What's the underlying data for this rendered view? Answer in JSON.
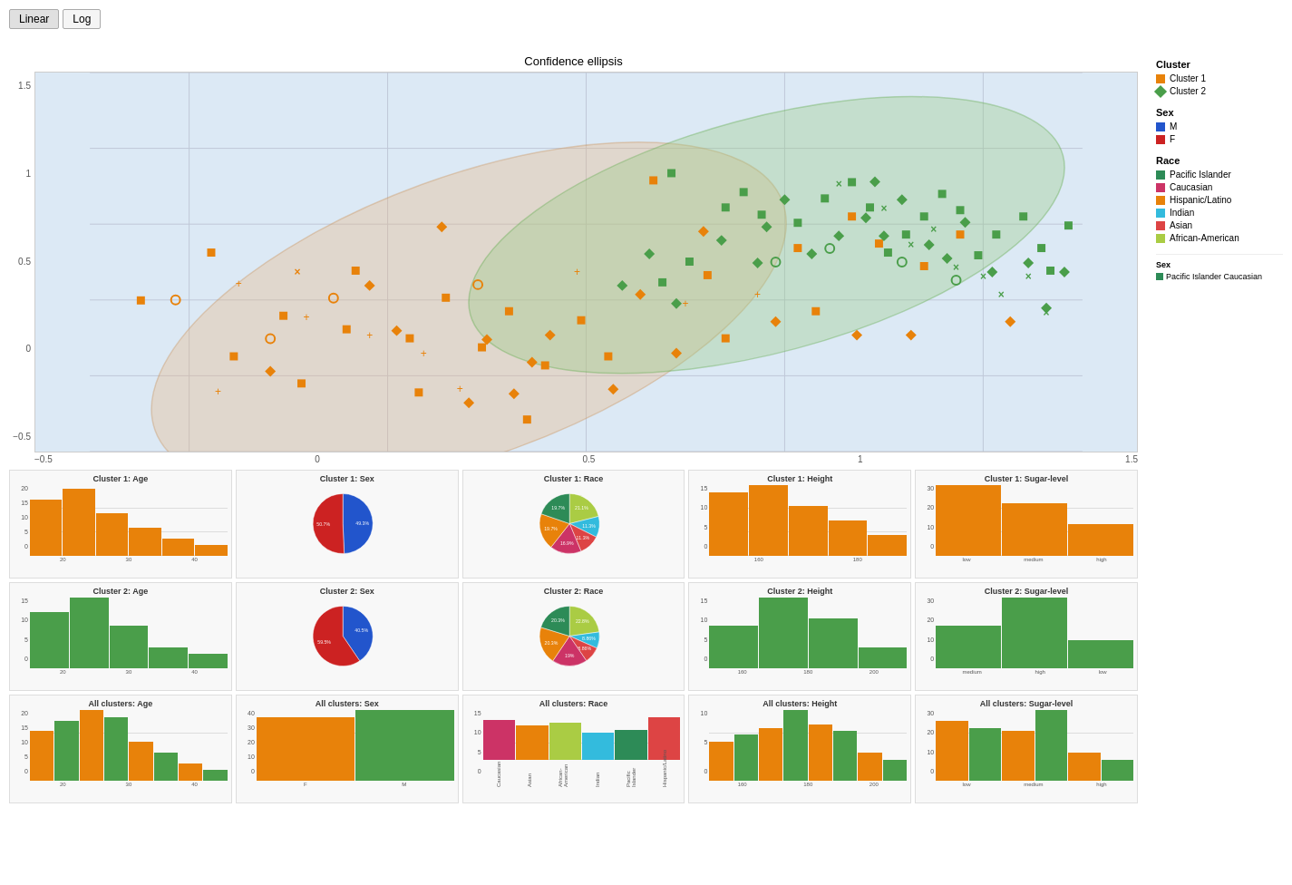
{
  "buttons": {
    "linear_label": "Linear",
    "log_label": "Log"
  },
  "scatter": {
    "title": "Confidence ellipsis",
    "x_ticks": [
      "-0.5",
      "0",
      "0.5",
      "1",
      "1.5"
    ],
    "y_ticks": [
      "1.5",
      "1",
      "0.5",
      "0",
      "-0.5"
    ]
  },
  "legend": {
    "cluster_title": "Cluster",
    "cluster_items": [
      {
        "label": "Cluster 1",
        "color": "#E8820A",
        "shape": "square"
      },
      {
        "label": "Cluster 2",
        "color": "#4A9E4A",
        "shape": "diamond"
      }
    ],
    "sex_title": "Sex",
    "sex_items": [
      {
        "label": "M",
        "color": "#2255CC"
      },
      {
        "label": "F",
        "color": "#CC2222"
      }
    ],
    "race_title": "Race",
    "race_items": [
      {
        "label": "Pacific Islander",
        "color": "#2D8B57"
      },
      {
        "label": "Caucasian",
        "color": "#CC3366"
      },
      {
        "label": "Hispanic/Latino",
        "color": "#E8820A"
      },
      {
        "label": "Indian",
        "color": "#33BBDD"
      },
      {
        "label": "Asian",
        "color": "#DD4444"
      },
      {
        "label": "African-American",
        "color": "#AACC44"
      }
    ]
  },
  "mini_charts": {
    "row1": [
      {
        "title": "Cluster 1: Age",
        "type": "bar",
        "y_max": 20,
        "y_ticks": [
          "20",
          "15",
          "10",
          "5",
          "0"
        ],
        "x_ticks": [
          "20",
          "30",
          "40"
        ],
        "bars": [
          {
            "height": 80,
            "color": "#E8820A"
          },
          {
            "height": 95,
            "color": "#E8820A"
          },
          {
            "height": 60,
            "color": "#E8820A"
          },
          {
            "height": 40,
            "color": "#E8820A"
          },
          {
            "height": 25,
            "color": "#E8820A"
          },
          {
            "height": 15,
            "color": "#E8820A"
          }
        ]
      },
      {
        "title": "Cluster 1: Sex",
        "type": "pie",
        "segments": [
          {
            "label": "49.3%",
            "color": "#2255CC",
            "pct": 49.3
          },
          {
            "label": "50.7%",
            "color": "#CC2222",
            "pct": 50.7
          }
        ]
      },
      {
        "title": "Cluster 1: Race",
        "type": "pie",
        "segments": [
          {
            "label": "21.1%",
            "color": "#AACC44",
            "pct": 21.1
          },
          {
            "label": "11.3%",
            "color": "#33BBDD",
            "pct": 11.3
          },
          {
            "label": "11.3%",
            "color": "#DD4444",
            "pct": 11.3
          },
          {
            "label": "16.9%",
            "color": "#CC3366",
            "pct": 16.9
          },
          {
            "label": "19.7%",
            "color": "#E8820A",
            "pct": 19.7
          },
          {
            "label": "19.7%",
            "color": "#2D8B57",
            "pct": 19.7
          }
        ]
      },
      {
        "title": "Cluster 1: Height",
        "type": "bar",
        "y_max": 15,
        "y_ticks": [
          "15",
          "10",
          "5",
          "0"
        ],
        "x_ticks": [
          "160",
          "180"
        ],
        "bars": [
          {
            "height": 90,
            "color": "#E8820A"
          },
          {
            "height": 100,
            "color": "#E8820A"
          },
          {
            "height": 70,
            "color": "#E8820A"
          },
          {
            "height": 50,
            "color": "#E8820A"
          },
          {
            "height": 30,
            "color": "#E8820A"
          }
        ]
      },
      {
        "title": "Cluster 1: Sugar-level",
        "type": "bar",
        "y_max": 30,
        "y_ticks": [
          "30",
          "20",
          "10",
          "0"
        ],
        "x_ticks": [
          "low",
          "medium",
          "high"
        ],
        "bars": [
          {
            "height": 100,
            "color": "#E8820A"
          },
          {
            "height": 75,
            "color": "#E8820A"
          },
          {
            "height": 45,
            "color": "#E8820A"
          }
        ]
      }
    ],
    "row2": [
      {
        "title": "Cluster 2: Age",
        "type": "bar",
        "y_max": 15,
        "y_ticks": [
          "15",
          "10",
          "5",
          "0"
        ],
        "x_ticks": [
          "20",
          "30",
          "40"
        ],
        "bars": [
          {
            "height": 80,
            "color": "#4A9E4A"
          },
          {
            "height": 100,
            "color": "#4A9E4A"
          },
          {
            "height": 60,
            "color": "#4A9E4A"
          },
          {
            "height": 30,
            "color": "#4A9E4A"
          },
          {
            "height": 20,
            "color": "#4A9E4A"
          }
        ]
      },
      {
        "title": "Cluster 2: Sex",
        "type": "pie",
        "segments": [
          {
            "label": "40.5%",
            "color": "#2255CC",
            "pct": 40.5
          },
          {
            "label": "59.5%",
            "color": "#CC2222",
            "pct": 59.5
          }
        ]
      },
      {
        "title": "Cluster 2: Race",
        "type": "pie",
        "segments": [
          {
            "label": "22.8%",
            "color": "#AACC44",
            "pct": 22.8
          },
          {
            "label": "8.86%",
            "color": "#33BBDD",
            "pct": 8.86
          },
          {
            "label": "8.86%",
            "color": "#DD4444",
            "pct": 8.86
          },
          {
            "label": "19%",
            "color": "#CC3366",
            "pct": 19
          },
          {
            "label": "20.3%",
            "color": "#E8820A",
            "pct": 20.3
          },
          {
            "label": "20.3%",
            "color": "#2D8B57",
            "pct": 20.3
          }
        ]
      },
      {
        "title": "Cluster 2: Height",
        "type": "bar",
        "y_max": 15,
        "y_ticks": [
          "15",
          "10",
          "5",
          "0"
        ],
        "x_ticks": [
          "160",
          "180",
          "200"
        ],
        "bars": [
          {
            "height": 60,
            "color": "#4A9E4A"
          },
          {
            "height": 100,
            "color": "#4A9E4A"
          },
          {
            "height": 70,
            "color": "#4A9E4A"
          },
          {
            "height": 30,
            "color": "#4A9E4A"
          }
        ]
      },
      {
        "title": "Cluster 2: Sugar-level",
        "type": "bar",
        "y_max": 30,
        "y_ticks": [
          "30",
          "20",
          "10",
          "0"
        ],
        "x_ticks": [
          "medium",
          "high",
          "low"
        ],
        "bars": [
          {
            "height": 60,
            "color": "#4A9E4A"
          },
          {
            "height": 100,
            "color": "#4A9E4A"
          },
          {
            "height": 40,
            "color": "#4A9E4A"
          }
        ]
      }
    ],
    "row3": [
      {
        "title": "All clusters: Age",
        "type": "bar",
        "y_max": 20,
        "y_ticks": [
          "20",
          "15",
          "10",
          "5",
          "0"
        ],
        "x_ticks": [
          "20",
          "30",
          "40"
        ],
        "bars": [
          {
            "height": 70,
            "color": "#E8820A"
          },
          {
            "height": 85,
            "color": "#4A9E4A"
          },
          {
            "height": 100,
            "color": "#E8820A"
          },
          {
            "height": 90,
            "color": "#4A9E4A"
          },
          {
            "height": 55,
            "color": "#E8820A"
          },
          {
            "height": 40,
            "color": "#4A9E4A"
          },
          {
            "height": 25,
            "color": "#E8820A"
          },
          {
            "height": 15,
            "color": "#4A9E4A"
          }
        ]
      },
      {
        "title": "All clusters: Sex",
        "type": "bar",
        "y_max": 40,
        "y_ticks": [
          "40",
          "30",
          "20",
          "10",
          "0"
        ],
        "x_ticks": [
          "F",
          "M"
        ],
        "bars": [
          {
            "height": 90,
            "color": "#E8820A"
          },
          {
            "height": 100,
            "color": "#4A9E4A"
          }
        ]
      },
      {
        "title": "All clusters: Race",
        "type": "bar_race",
        "y_max": 15,
        "y_ticks": [
          "15",
          "10",
          "5",
          "0"
        ],
        "x_ticks": [
          "Caucasian",
          "Asian",
          "African-American",
          "Indian",
          "Pacific Islander",
          "Hispanic/Latino"
        ],
        "bars": [
          {
            "height": 80,
            "color": "#CC3366"
          },
          {
            "height": 70,
            "color": "#E8820A"
          },
          {
            "height": 75,
            "color": "#AACC44"
          },
          {
            "height": 55,
            "color": "#33BBDD"
          },
          {
            "height": 60,
            "color": "#2D8B57"
          },
          {
            "height": 85,
            "color": "#DD4444"
          }
        ]
      },
      {
        "title": "All clusters: Height",
        "type": "bar",
        "y_max": 10,
        "y_ticks": [
          "10",
          "5",
          "0"
        ],
        "x_ticks": [
          "160",
          "180",
          "200"
        ],
        "bars": [
          {
            "height": 55,
            "color": "#E8820A"
          },
          {
            "height": 65,
            "color": "#4A9E4A"
          },
          {
            "height": 75,
            "color": "#E8820A"
          },
          {
            "height": 100,
            "color": "#4A9E4A"
          },
          {
            "height": 80,
            "color": "#E8820A"
          },
          {
            "height": 70,
            "color": "#4A9E4A"
          },
          {
            "height": 40,
            "color": "#E8820A"
          },
          {
            "height": 30,
            "color": "#4A9E4A"
          }
        ]
      },
      {
        "title": "All clusters: Sugar-level",
        "type": "bar",
        "y_max": 30,
        "y_ticks": [
          "30",
          "20",
          "10",
          "0"
        ],
        "x_ticks": [
          "low",
          "medium",
          "high"
        ],
        "bars": [
          {
            "height": 85,
            "color": "#E8820A"
          },
          {
            "height": 75,
            "color": "#4A9E4A"
          },
          {
            "height": 70,
            "color": "#E8820A"
          },
          {
            "height": 100,
            "color": "#4A9E4A"
          },
          {
            "height": 40,
            "color": "#E8820A"
          },
          {
            "height": 30,
            "color": "#4A9E4A"
          }
        ]
      }
    ]
  }
}
